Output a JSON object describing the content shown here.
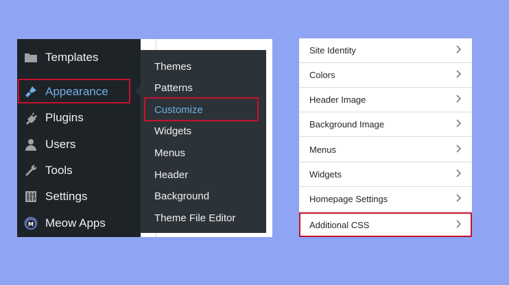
{
  "sidebar": {
    "items": [
      {
        "label": "Templates",
        "icon": "folder-icon"
      },
      {
        "label": "Appearance",
        "icon": "paintbrush-icon",
        "current": true
      },
      {
        "label": "Plugins",
        "icon": "plug-icon"
      },
      {
        "label": "Users",
        "icon": "user-icon"
      },
      {
        "label": "Tools",
        "icon": "wrench-icon"
      },
      {
        "label": "Settings",
        "icon": "sliders-icon"
      },
      {
        "label": "Meow Apps",
        "icon": "meow-apps-logo-icon"
      }
    ]
  },
  "flyout": {
    "items": [
      {
        "label": "Themes"
      },
      {
        "label": "Patterns"
      },
      {
        "label": "Customize",
        "current": true
      },
      {
        "label": "Widgets"
      },
      {
        "label": "Menus"
      },
      {
        "label": "Header"
      },
      {
        "label": "Background"
      },
      {
        "label": "Theme File Editor"
      }
    ]
  },
  "customizer": {
    "sections": [
      {
        "label": "Site Identity"
      },
      {
        "label": "Colors"
      },
      {
        "label": "Header Image"
      },
      {
        "label": "Background Image"
      },
      {
        "label": "Menus"
      },
      {
        "label": "Widgets"
      },
      {
        "label": "Homepage Settings"
      },
      {
        "label": "Additional CSS",
        "highlighted": true
      }
    ]
  },
  "colors": {
    "background": "#8fa5f3",
    "sidebar": "#1d2327",
    "flyout": "#2c3338",
    "active_link": "#72aee6",
    "highlight_border": "#c8102e"
  }
}
